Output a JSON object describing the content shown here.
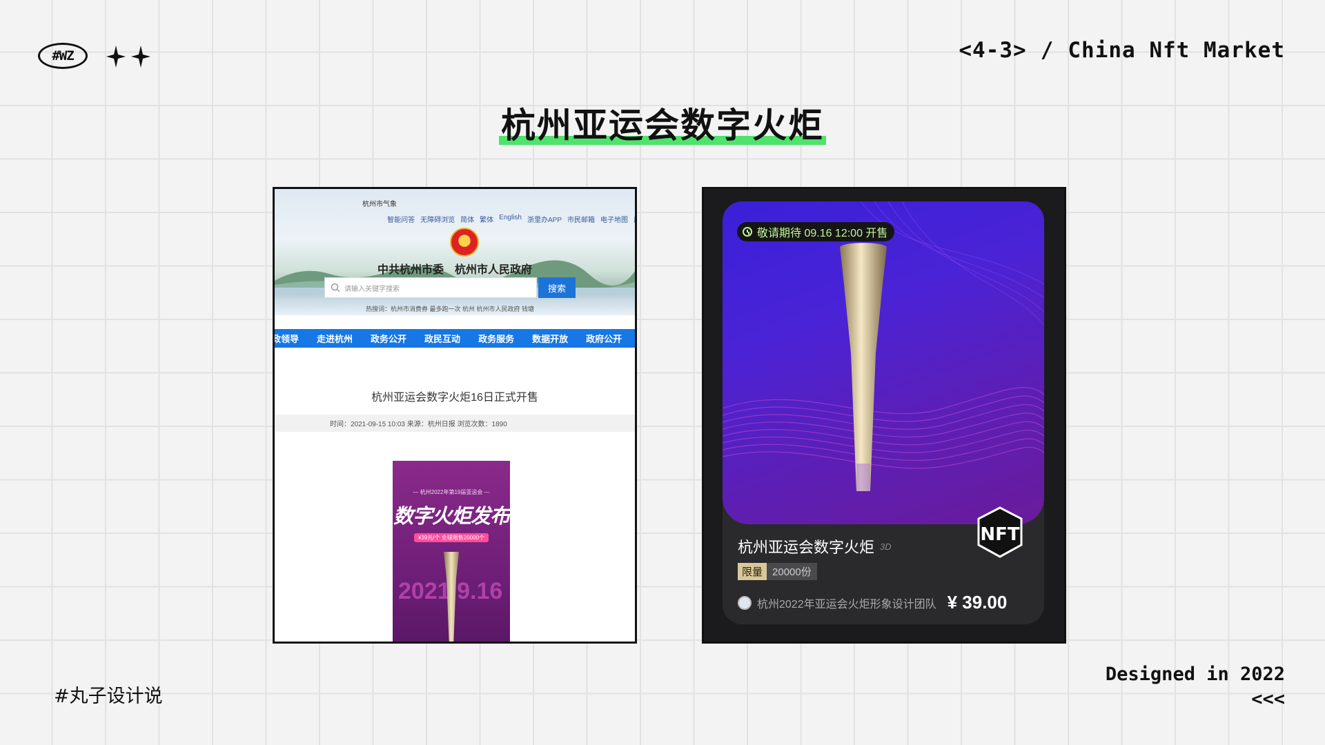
{
  "header": {
    "logo_text": "#WZ",
    "page_index": "<4-3>",
    "separator": "/",
    "series_title": "China Nft Market"
  },
  "title": "杭州亚运会数字火炬",
  "left_screenshot": {
    "weather": "杭州市气象",
    "top_nav": [
      "智能问答",
      "无障碍浏览",
      "简体",
      "繁体",
      "English",
      "浙里办APP",
      "市民邮箱",
      "电子地图",
      "用"
    ],
    "gov_name": "中共杭州市委　杭州市人民政府",
    "search_placeholder": "请输入关键字搜索",
    "search_button": "搜索",
    "hot_search": "热搜词：杭州市消费券  最多跑一次  杭州  杭州市人民政府  钱塘",
    "main_nav": [
      "政领导",
      "走进杭州",
      "政务公开",
      "政民互动",
      "政务服务",
      "数据开放",
      "政府公开"
    ],
    "article_title": "杭州亚运会数字火炬16日正式开售",
    "article_meta": "时间：2021-09-15 10:03  来源：杭州日报  浏览次数：1890",
    "poster": {
      "sub": "— 杭州2022年第19届亚运会 —",
      "main": "数字火炬发布",
      "tag": "¥39元/个  全球限售20000个",
      "date": "2021.9.16"
    }
  },
  "right_screenshot": {
    "countdown": "敬请期待 09.16 12:00 开售",
    "badge": "NFT",
    "name": "杭州亚运会数字火炬",
    "name_tag": "3D",
    "limit_label": "限量",
    "limit_count": "20000份",
    "creator": "杭州2022年亚运会火炬形象设计团队",
    "price": "¥ 39.00"
  },
  "footer": {
    "left": "#丸子设计说",
    "right_line1": "Designed in 2022",
    "right_line2": "<<<"
  },
  "colors": {
    "highlight": "#4ee36b",
    "gov_blue": "#1677e5",
    "nft_purple": "#4a23d6",
    "countdown_green": "#bff59a"
  }
}
